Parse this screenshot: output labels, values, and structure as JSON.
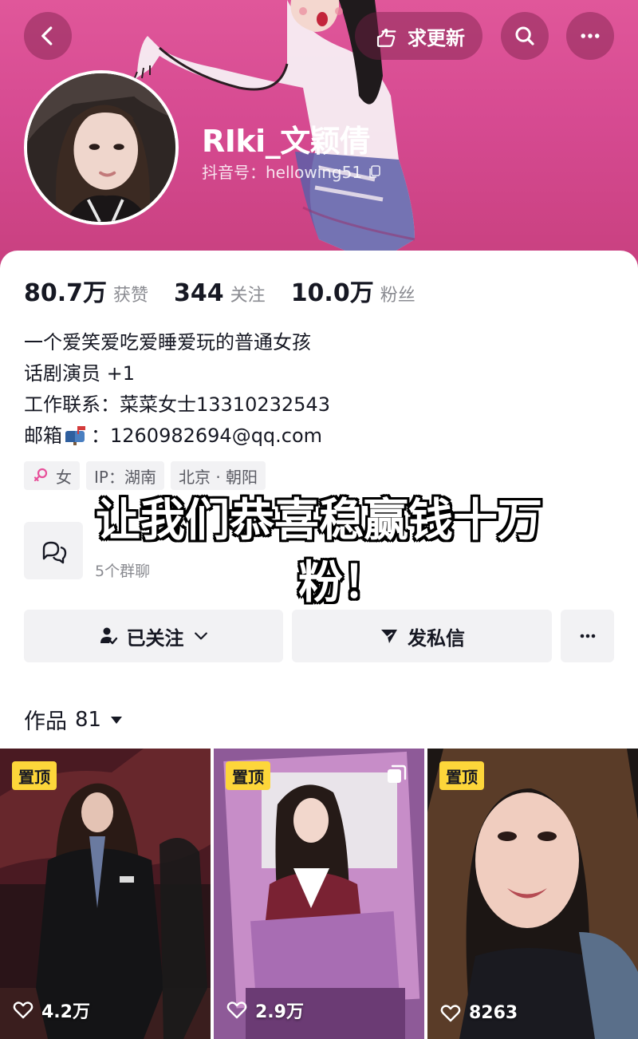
{
  "header": {
    "update_label": "求更新",
    "nickname": "RIki_文颖倩",
    "douyin_id": "抖音号：hellowing51"
  },
  "stats": [
    {
      "num": "80.7万",
      "label": "获赞"
    },
    {
      "num": "344",
      "label": "关注"
    },
    {
      "num": "10.0万",
      "label": "粉丝"
    }
  ],
  "bio": {
    "line1": "一个爱笑爱吃爱睡爱玩的普通女孩",
    "line2": "话剧演员 +1",
    "line3": "工作联系：菜菜女士13310232543",
    "line4_prefix": "邮箱",
    "line4_suffix": "：1260982694@qq.com"
  },
  "tags": {
    "gender": "女",
    "ip": "IP：湖南",
    "location": "北京 · 朝阳"
  },
  "group": {
    "count_label": "5个群聊"
  },
  "overlay_caption": {
    "line1": "让我们恭喜稳赢钱十万",
    "line2": "粉！"
  },
  "actions": {
    "follow_label": "已关注",
    "message_label": "发私信"
  },
  "works": {
    "label": "作品",
    "count": "81"
  },
  "videos": [
    {
      "pin_label": "置顶",
      "likes": "4.2万"
    },
    {
      "pin_label": "置顶",
      "likes": "2.9万"
    },
    {
      "pin_label": "置顶",
      "likes": "8263"
    }
  ],
  "colors": {
    "banner": "#d64a91",
    "pin": "#fdd63a",
    "gender_symbol": "#e7509a"
  }
}
